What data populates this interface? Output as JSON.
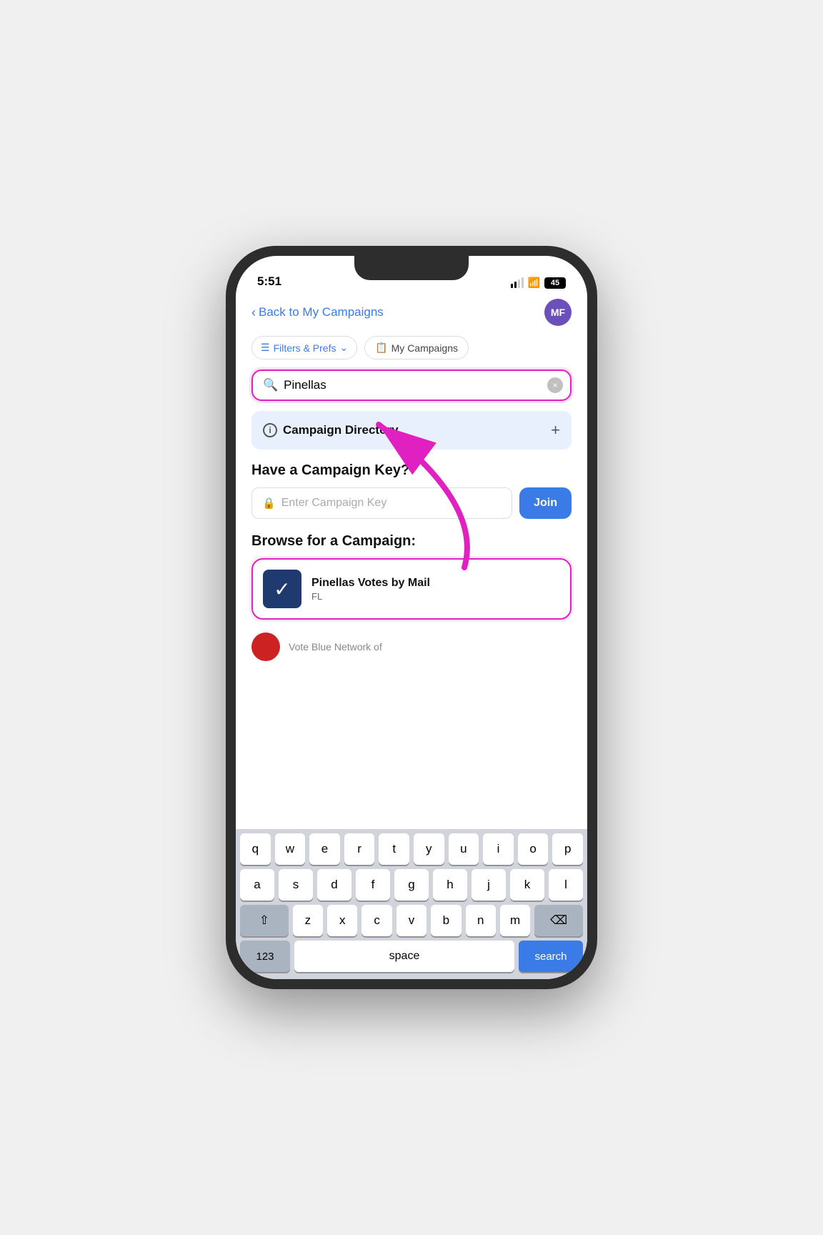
{
  "status_bar": {
    "time": "5:51",
    "signal": "signal",
    "wifi": "wifi",
    "battery": "45"
  },
  "nav": {
    "back_label": "Back to My Campaigns",
    "avatar_initials": "MF"
  },
  "filter_bar": {
    "filters_label": "Filters & Prefs",
    "my_campaigns_label": "My Campaigns"
  },
  "search": {
    "placeholder": "Pinellas",
    "search_icon": "search",
    "clear_icon": "×"
  },
  "campaign_directory": {
    "label": "Campaign Directory",
    "plus": "+"
  },
  "campaign_key_section": {
    "title": "Have a Campaign Key?",
    "placeholder": "Enter Campaign Key",
    "join_label": "Join"
  },
  "browse_section": {
    "title": "Browse for a Campaign:",
    "campaigns": [
      {
        "name": "Pinellas Votes by Mail",
        "state": "FL",
        "logo_char": "✓"
      }
    ],
    "partial_label": "Vote Blue Network of"
  },
  "keyboard": {
    "rows": [
      [
        "q",
        "w",
        "e",
        "r",
        "t",
        "y",
        "u",
        "i",
        "o",
        "p"
      ],
      [
        "a",
        "s",
        "d",
        "f",
        "g",
        "h",
        "j",
        "k",
        "l"
      ],
      [
        "z",
        "x",
        "c",
        "v",
        "b",
        "n",
        "m"
      ]
    ],
    "space_label": "space",
    "search_label": "search",
    "num_label": "123"
  }
}
